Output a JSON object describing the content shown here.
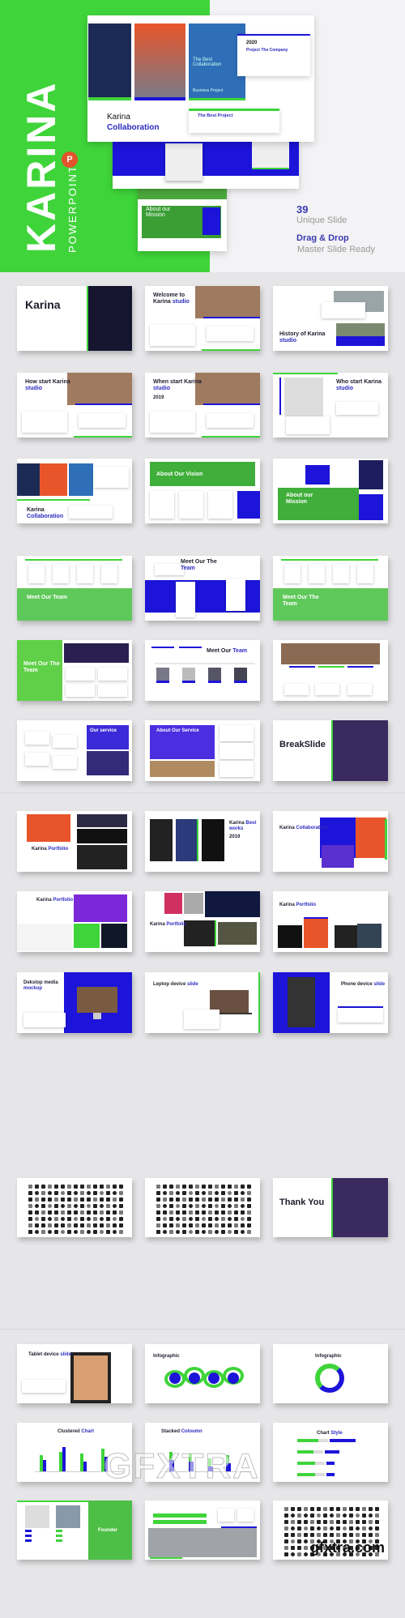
{
  "colors": {
    "green": "#3fd43a",
    "blue": "#1c14d8",
    "navy": "#2b2bc0",
    "dark": "#1d1d2b",
    "purple": "#5a2fd0"
  },
  "hero": {
    "brand": "KARINA",
    "subtitle": "POWERPOINT",
    "app_icon": "powerpoint-icon",
    "app_icon_letter": "P",
    "slide": {
      "title": "Karina",
      "title_accent": "Collaboration",
      "year": "2020",
      "project": "Project The Company",
      "best_collab": "The Best Collaboration",
      "best_project": "The Best Project",
      "business_project": "Business Project"
    },
    "mission": "About our Mission",
    "features": {
      "count": "39",
      "count_label": "Unique Slide",
      "dnd": "Drag & Drop",
      "dnd_label": "Master Slide Ready"
    }
  },
  "grid": {
    "slides": [
      {
        "kind": "cover",
        "title": "Karina",
        "accent": ""
      },
      {
        "kind": "photo-right",
        "title": "Welcome to Karina",
        "accent": "studio"
      },
      {
        "kind": "photo-right2",
        "title": "History of Karina",
        "accent": "studio"
      },
      {
        "kind": "photo-right",
        "title": "How start Karina",
        "accent": "studio"
      },
      {
        "kind": "photo-right",
        "title": "When start Karina",
        "accent": "studio",
        "extra": "2019"
      },
      {
        "kind": "photo-left",
        "title": "Who start Karina",
        "accent": "studio"
      },
      {
        "kind": "collab",
        "title": "Karina",
        "accent": "Collaboration"
      },
      {
        "kind": "green-top",
        "title": "About Our Vision",
        "accent": ""
      },
      {
        "kind": "green-bottom-right",
        "title": "About our Mission",
        "accent": ""
      },
      {
        "kind": "green-bottom",
        "title": "Meet Our Team",
        "accent": ""
      },
      {
        "kind": "blue-band",
        "title": "Meet Our The",
        "accent": "Team"
      },
      {
        "kind": "green-bottom",
        "title": "Meet Our The Team",
        "accent": ""
      },
      {
        "kind": "green-left",
        "title": "Meet Our The Team",
        "accent": ""
      },
      {
        "kind": "team",
        "title": "Meet Our",
        "accent": "Team"
      },
      {
        "kind": "photos-top",
        "title": "",
        "accent": ""
      },
      {
        "kind": "purple-right",
        "title": "Our service",
        "accent": ""
      },
      {
        "kind": "purple-left",
        "title": "About Our Service",
        "accent": ""
      },
      {
        "kind": "break",
        "title": "BreakSlide",
        "accent": ""
      },
      {
        "kind": "portfolio-a",
        "title": "Karina",
        "accent": "Portfolio"
      },
      {
        "kind": "portfolio-b",
        "title": "Karina",
        "accent": "Best works",
        "extra": "2019"
      },
      {
        "kind": "portfolio-c",
        "title": "Karina",
        "accent": "Collaboration"
      },
      {
        "kind": "portfolio-d",
        "title": "Karina",
        "accent": "Portfolio"
      },
      {
        "kind": "portfolio-e",
        "title": "Karina",
        "accent": "Portfolio"
      },
      {
        "kind": "portfolio-f",
        "title": "Karina",
        "accent": "Portfolio"
      },
      {
        "kind": "device-desktop",
        "title": "Dekstop media",
        "accent": "mockup"
      },
      {
        "kind": "device-laptop",
        "title": "Leptop device",
        "accent": "slide"
      },
      {
        "kind": "device-phone",
        "title": "Phone device",
        "accent": "slide"
      },
      {
        "kind": "icons",
        "title": "",
        "accent": ""
      },
      {
        "kind": "icons",
        "title": "",
        "accent": ""
      },
      {
        "kind": "break",
        "title": "Thank You",
        "accent": ""
      },
      {
        "kind": "device-tablet",
        "title": "Tablet device",
        "accent": "slide"
      },
      {
        "kind": "wave",
        "title": "Infographic",
        "accent": ""
      },
      {
        "kind": "ring",
        "title": "Infographic",
        "accent": ""
      },
      {
        "kind": "clustered",
        "title": "Clustered",
        "accent": "Chart"
      },
      {
        "kind": "stacked",
        "title": "Stacked",
        "accent": "Coloumn"
      },
      {
        "kind": "hbar",
        "title": "Chart",
        "accent": "Style"
      },
      {
        "kind": "founder",
        "title": "Founder",
        "accent": ""
      },
      {
        "kind": "contact",
        "title": "",
        "accent": ""
      },
      {
        "kind": "icons",
        "title": "",
        "accent": ""
      }
    ]
  },
  "watermark": {
    "site": "gfxtra.com",
    "mark": "GFXTRA"
  }
}
